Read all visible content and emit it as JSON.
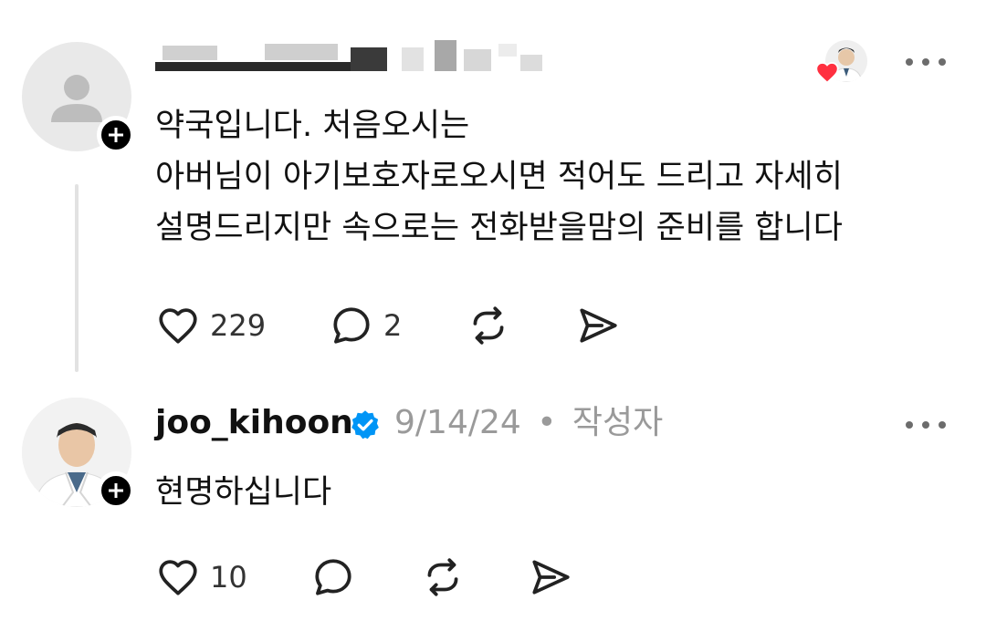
{
  "post1": {
    "username_redacted": true,
    "body": "약국입니다. 처음오시는\n아버님이 아기보호자로오시면 적어도 드리고 자세히\n설명드리지만 속으로는 전화받을맘의 준비를 합니다",
    "icons": {
      "avatar": "default-avatar-icon",
      "follow": "plus-icon",
      "liked_by": "heart-icon",
      "more": "more-icon"
    },
    "actions": {
      "like_count": "229",
      "reply_count": "2",
      "icons": [
        "heart-outline-icon",
        "comment-icon",
        "repost-icon",
        "share-icon"
      ]
    }
  },
  "post2": {
    "username": "joo_kihoon",
    "date": "9/14/24",
    "separator": "•",
    "author_label": "작성자",
    "body": "현명하십니다",
    "icons": {
      "verified": "verified-badge-icon",
      "follow": "plus-icon",
      "more": "more-icon"
    },
    "actions": {
      "like_count": "10",
      "icons": [
        "heart-outline-icon",
        "comment-icon",
        "repost-icon",
        "share-icon"
      ]
    }
  },
  "colors": {
    "text": "#111111",
    "muted": "#9a9a9a",
    "verified": "#0095f6",
    "heart": "#ff3040",
    "thread_line": "#e2e2e2"
  }
}
